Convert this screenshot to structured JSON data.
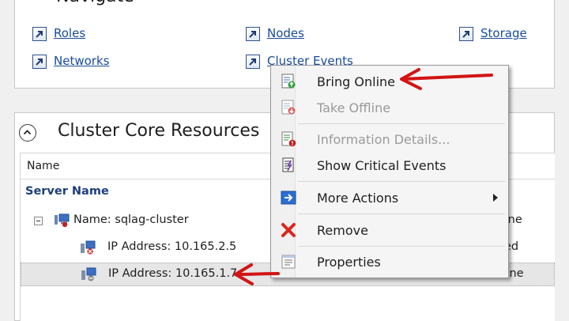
{
  "navigate": {
    "title": "Navigate",
    "links": [
      {
        "label": "Roles"
      },
      {
        "label": "Nodes"
      },
      {
        "label": "Storage"
      },
      {
        "label": "Networks"
      },
      {
        "label": "Cluster Events"
      }
    ]
  },
  "core_resources": {
    "title": "Cluster Core Resources",
    "column_name": "Name",
    "group_header": "Server Name",
    "rows": [
      {
        "label": "Name: sqlag-cluster",
        "status": "Online"
      },
      {
        "label": "IP Address: 10.165.2.5",
        "status": "Failed"
      },
      {
        "label": "IP Address: 10.165.1.7",
        "status": "Offline"
      }
    ]
  },
  "context_menu": {
    "items": [
      {
        "label": "Bring Online",
        "enabled": true,
        "icon": "bring-online-icon"
      },
      {
        "label": "Take Offline",
        "enabled": false,
        "icon": "take-offline-icon"
      },
      {
        "label": "Information Details...",
        "enabled": false,
        "icon": "information-details-icon"
      },
      {
        "label": "Show Critical Events",
        "enabled": true,
        "icon": "critical-events-icon"
      },
      {
        "label": "More Actions",
        "enabled": true,
        "icon": "more-actions-icon",
        "submenu": true
      },
      {
        "label": "Remove",
        "enabled": true,
        "icon": "remove-icon"
      },
      {
        "label": "Properties",
        "enabled": true,
        "icon": "properties-icon"
      }
    ]
  },
  "colors": {
    "annotation_arrow": "#d21414",
    "link": "#1a4a9c",
    "selected_row": "#e5e5e5"
  }
}
